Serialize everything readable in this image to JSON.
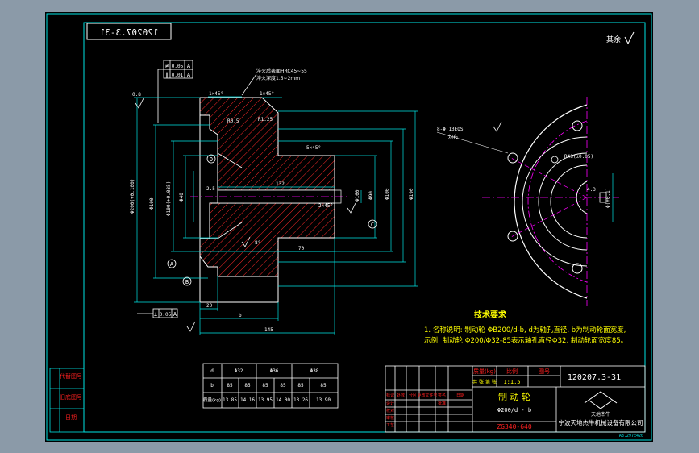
{
  "colors": {
    "frame_bg": "#8b9aa8",
    "sheet": "#000000",
    "border": "#00e5e5",
    "part_outline": "#ffffff",
    "hatch": "#ff2a2a",
    "dimension": "#00e5e5",
    "centerline": "#ff00ff",
    "text_yellow": "#ffff00",
    "text_red": "#ff2020"
  },
  "drawing_no_mirrored": "120207.3-31",
  "roughness_label": "其余",
  "tolerance_frames": {
    "top_row1": [
      "≠",
      "0.05",
      "A"
    ],
    "top_row2": [
      "∥",
      "0.01",
      "A"
    ],
    "bottom": [
      "⊥",
      "0.05",
      "A"
    ]
  },
  "notes": {
    "hardness": "淬火后表面HRC45~55",
    "depth": "淬火深度1.5~2mm"
  },
  "datums": [
    "A",
    "B",
    "C",
    "D"
  ],
  "dimensions": {
    "d_outer": "Φ200(+0.100)",
    "d_hub": "Φ100",
    "d_bore": "Φ40",
    "d_right1": "Φ90",
    "d_right2": "Φ100",
    "d_right3": "Φ190",
    "d_left_mid": "Φ100(+0.035)",
    "len_inner": "132",
    "len_mid": "70",
    "len_total": "145",
    "len_small": "20",
    "chamfer1": "1×45°",
    "chamfer2": "1×45°",
    "chamfer3": "5×45°",
    "chamfer4": "2×45°",
    "r1": "R0.5",
    "r2": "R1.25",
    "ang": "8°",
    "d_d": "Φ160",
    "small1": "2.5",
    "small2": "0.8",
    "slot": "b"
  },
  "side_view": {
    "keyway": "8-Φ 13EQS",
    "note": "均布",
    "dim_a": "R48(±0.05)",
    "dim_b": "4.3",
    "dim_c": "Φ(+0.1)"
  },
  "tech_requirements": {
    "title": "技术要求",
    "line1": "1. 名称说明: 制动轮 ΦB200/d-b, d为轴孔直径, b为制动轮面宽度,",
    "line2": "示例: 制动轮 Φ200/Φ32-85表示轴孔直径Φ32, 制动轮面宽度85。"
  },
  "param_table": {
    "header": [
      "d",
      "Φ32",
      "",
      "Φ36",
      "",
      "Φ38",
      ""
    ],
    "row_b": [
      "b",
      "85",
      "85",
      "85",
      "85",
      "85",
      "85"
    ],
    "row_w": [
      "质量(kg)",
      "13.85",
      "14.16",
      "13.95",
      "14.00",
      "13.26",
      "13.90"
    ]
  },
  "left_strip": [
    "代替图号",
    "旧底图号",
    "日期"
  ],
  "title_block": {
    "drawing_no": "120207.3-31",
    "part_name": "制 动 轮",
    "part_spec": "Φ200/d - b",
    "material_code": "ZG340-640",
    "company": "宁波天地杰牛机械设备有限公司",
    "logo_text": "天地杰牛",
    "hdr_weight": "质量(kg)",
    "hdr_scale": "比例",
    "hdr_sheet": "图号",
    "scale": "1:1.5",
    "sheets": "共 张  第 张",
    "rev_headers": [
      "标记",
      "处数",
      "分区",
      "更改文件号",
      "签名",
      "日期"
    ],
    "roles": [
      "设计",
      "校对",
      "审核",
      "工艺",
      "批准"
    ]
  },
  "bottom_right_code": "A3.297x420"
}
